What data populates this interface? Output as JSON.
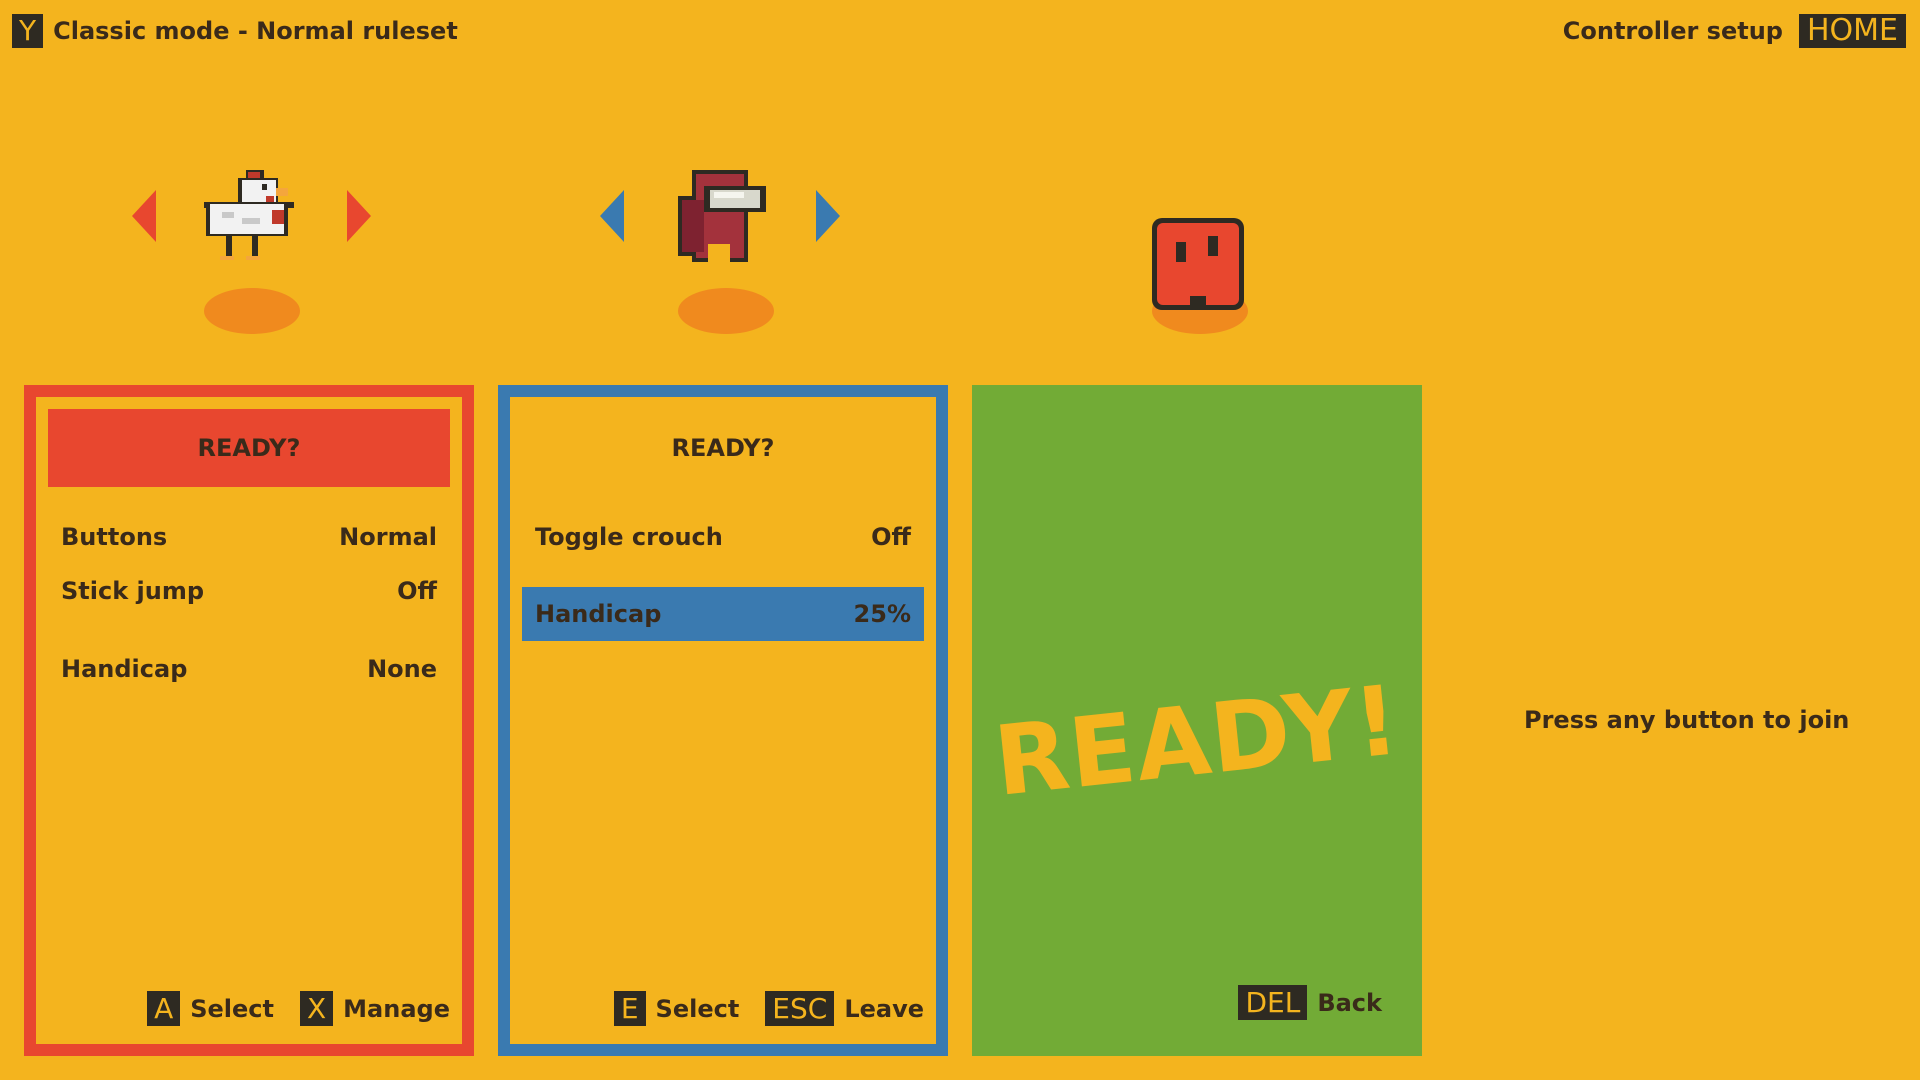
{
  "topbar": {
    "mode_key": "Y",
    "mode_label": "Classic mode - Normal ruleset",
    "controller_setup": "Controller setup",
    "home_label": "HOME"
  },
  "players": [
    {
      "character": "chicken-icon",
      "color": "#e8472f",
      "ready_label": "READY?",
      "options": [
        {
          "label": "Buttons",
          "value": "Normal"
        },
        {
          "label": "Stick jump",
          "value": "Off"
        },
        {
          "label": "Handicap",
          "value": "None"
        }
      ],
      "footer": [
        {
          "key": "A",
          "label": "Select"
        },
        {
          "key": "X",
          "label": "Manage"
        }
      ]
    },
    {
      "character": "hooded-figure-icon",
      "color": "#3a7ab0",
      "ready_label": "READY?",
      "options": [
        {
          "label": "Toggle crouch",
          "value": "Off"
        },
        {
          "label": "Handicap",
          "value": "25%",
          "selected": true
        }
      ],
      "footer": [
        {
          "key": "E",
          "label": "Select"
        },
        {
          "key": "ESC",
          "label": "Leave"
        }
      ]
    },
    {
      "character": "red-blob-icon",
      "color": "#72ab36",
      "ready_text": "READY!",
      "footer": [
        {
          "key": "DEL",
          "label": "Back"
        }
      ]
    }
  ],
  "join_prompt": "Press any button to join",
  "colors": {
    "background": "#f4b41e",
    "player1": "#e8472f",
    "player2": "#3a7ab0",
    "player3": "#72ab36",
    "shadow": "#f08a1e",
    "key_bg": "#2e2a22"
  }
}
